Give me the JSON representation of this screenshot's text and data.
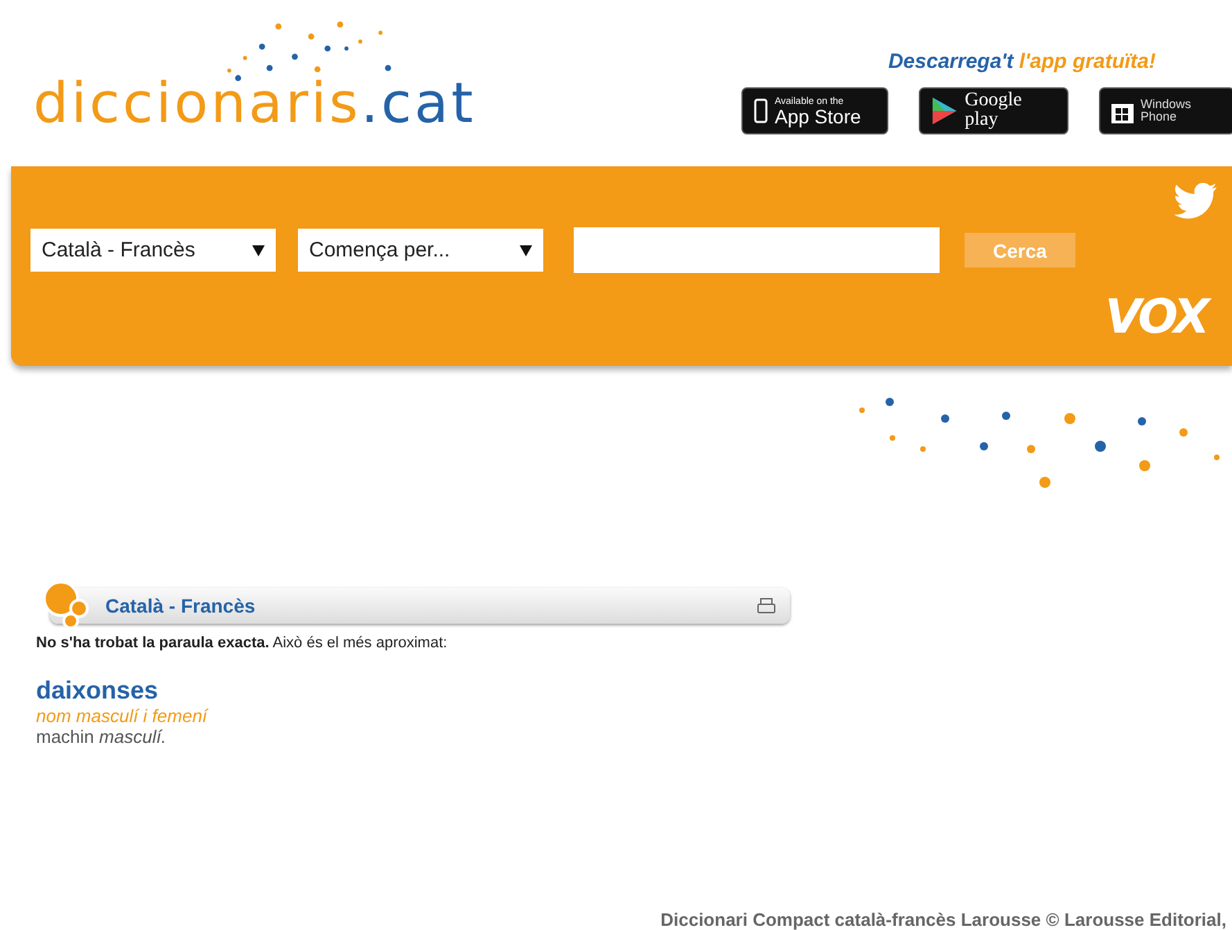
{
  "logo": {
    "name": "diccionaris",
    "suffix": ".cat"
  },
  "promo": {
    "lead": "Descarrega't",
    "rest": "l'app gratuïta!"
  },
  "store_badges": [
    {
      "kind": "apple",
      "small": "Available on the",
      "big": "App Store"
    },
    {
      "kind": "google",
      "big": "Google play"
    },
    {
      "kind": "windows",
      "small": "Windows",
      "big": "Phone"
    }
  ],
  "search_bar": {
    "dictionary_select": "Català - Francès",
    "mode_select": "Comença per...",
    "search_button": "Cerca",
    "brand": "VOX"
  },
  "result_panel": {
    "title": "Català - Francès",
    "message_bold": "No s'ha trobat la paraula exacta.",
    "message": "Això és el més aproximat:",
    "entry": {
      "headword": "daixonses",
      "category": "nom masculí i femení",
      "translation": "machin",
      "gender": "masculí."
    }
  },
  "footer": "Diccionari Compact català-francès Larousse © Larousse Editorial,"
}
